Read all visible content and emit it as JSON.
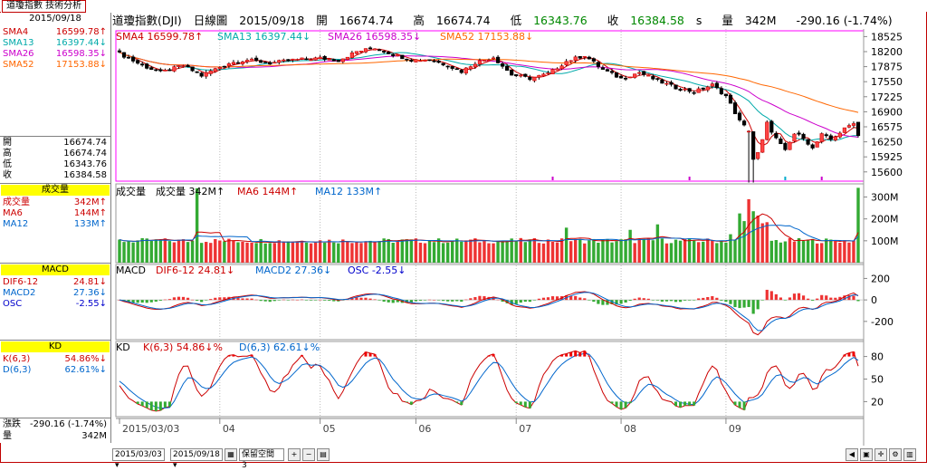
{
  "app": {
    "tab_label": "道瓊指數 技術分析"
  },
  "left": {
    "date": "2015/09/18",
    "sma": [
      {
        "label": "SMA4",
        "value": "16599.78",
        "arrow": "↑",
        "color": "#cc0000"
      },
      {
        "label": "SMA13",
        "value": "16397.44",
        "arrow": "↓",
        "color": "#00aaaa"
      },
      {
        "label": "SMA26",
        "value": "16598.35",
        "arrow": "↓",
        "color": "#cc00cc"
      },
      {
        "label": "SMA52",
        "value": "17153.88",
        "arrow": "↓",
        "color": "#ff6600"
      }
    ],
    "ohlc": [
      {
        "label": "開",
        "value": "16674.74"
      },
      {
        "label": "高",
        "value": "16674.74"
      },
      {
        "label": "低",
        "value": "16343.76"
      },
      {
        "label": "收",
        "value": "16384.58"
      }
    ],
    "vol_title": "成交量",
    "vol": [
      {
        "label": "成交量",
        "value": "342M",
        "arrow": "↑",
        "color": "#cc0000"
      },
      {
        "label": "MA6",
        "value": "144M",
        "arrow": "↑",
        "color": "#cc0000"
      },
      {
        "label": "MA12",
        "value": "133M",
        "arrow": "↑",
        "color": "#0066cc"
      }
    ],
    "macd_title": "MACD",
    "macd": [
      {
        "label": "DIF6-12",
        "value": "24.81",
        "arrow": "↓",
        "color": "#cc0000"
      },
      {
        "label": "MACD2",
        "value": "27.36",
        "arrow": "↓",
        "color": "#0066cc"
      },
      {
        "label": "OSC",
        "value": "-2.55",
        "arrow": "↓",
        "color": "#0000cc"
      }
    ],
    "kd_title": "KD",
    "kd": [
      {
        "label": "K(6,3)",
        "value": "54.86%",
        "arrow": "↓",
        "color": "#cc0000"
      },
      {
        "label": "D(6,3)",
        "value": "62.61%",
        "arrow": "↓",
        "color": "#0066cc"
      }
    ],
    "change_label": "漲跌",
    "change_value": "-290.16 (-1.74%)",
    "volume_label": "量",
    "volume_value": "342M"
  },
  "header": {
    "name": "道瓊指數(DJI)",
    "period": "日線圖",
    "date": "2015/09/18",
    "open_label": "開",
    "open": "16674.74",
    "high_label": "高",
    "high": "16674.74",
    "low_label": "低",
    "low": "16343.76",
    "close_label": "收",
    "close": "16384.58",
    "close_suffix": "s",
    "vol_label": "量",
    "vol": "342M",
    "change": "-290.16 (-1.74%)"
  },
  "panels": {
    "price": {
      "sma4": "SMA4 16599.78↑",
      "sma13": "SMA13 16397.44↓",
      "sma26": "SMA26 16598.35↓",
      "sma52": "SMA52 17153.88↓"
    },
    "volume": {
      "title": "成交量",
      "vol": "成交量 342M↑",
      "ma6": "MA6 144M↑",
      "ma12": "MA12 133M↑"
    },
    "macd": {
      "title": "MACD",
      "dif": "DIF6-12 24.81↓",
      "macd2": "MACD2 27.36↓",
      "osc": "OSC -2.55↓"
    },
    "kd": {
      "title": "KD",
      "k": "K(6,3) 54.86↓%",
      "d": "D(6,3) 62.61↓%"
    }
  },
  "bottom": {
    "start_date": "2015/03/03",
    "end_date": "2015/09/18",
    "btn_label": "保留空間",
    "btn_num": "3"
  },
  "chart_data": [
    {
      "type": "candlestick",
      "title": "道瓊指數(DJI) 日線圖",
      "x_ticks": [
        "2015/03/03",
        "04",
        "05",
        "06",
        "07",
        "08",
        "09"
      ],
      "y_ticks": [
        18525,
        18200,
        17875,
        17550,
        17225,
        16900,
        16575,
        16250,
        15925,
        15600
      ],
      "ylim": [
        15400,
        18650
      ],
      "close_anchors": [
        [
          0,
          18160
        ],
        [
          5,
          17900
        ],
        [
          9,
          17750
        ],
        [
          14,
          17900
        ],
        [
          18,
          17680
        ],
        [
          20,
          17780
        ],
        [
          24,
          17950
        ],
        [
          28,
          18020
        ],
        [
          33,
          17950
        ],
        [
          38,
          18020
        ],
        [
          44,
          18060
        ],
        [
          48,
          18010
        ],
        [
          52,
          18200
        ],
        [
          56,
          18280
        ],
        [
          60,
          18140
        ],
        [
          64,
          18020
        ],
        [
          68,
          18030
        ],
        [
          72,
          17900
        ],
        [
          75,
          17770
        ],
        [
          78,
          17960
        ],
        [
          82,
          18080
        ],
        [
          86,
          17700
        ],
        [
          90,
          17620
        ],
        [
          94,
          17720
        ],
        [
          98,
          17990
        ],
        [
          102,
          18120
        ],
        [
          106,
          17810
        ],
        [
          110,
          17620
        ],
        [
          114,
          17750
        ],
        [
          118,
          17570
        ],
        [
          122,
          17420
        ],
        [
          126,
          17330
        ],
        [
          130,
          17480
        ],
        [
          133,
          17240
        ],
        [
          136,
          16700
        ],
        [
          138,
          16480
        ],
        [
          139,
          15870
        ],
        [
          140,
          16000
        ],
        [
          141,
          16280
        ],
        [
          142,
          16650
        ],
        [
          144,
          16320
        ],
        [
          146,
          16050
        ],
        [
          148,
          16420
        ],
        [
          150,
          16350
        ],
        [
          152,
          16100
        ],
        [
          154,
          16400
        ],
        [
          156,
          16300
        ],
        [
          158,
          16450
        ],
        [
          160,
          16600
        ],
        [
          161,
          16674
        ],
        [
          162,
          16384
        ]
      ],
      "series": [
        {
          "name": "SMA4",
          "color": "#cc0000"
        },
        {
          "name": "SMA13",
          "color": "#00aaaa"
        },
        {
          "name": "SMA26",
          "color": "#cc00cc"
        },
        {
          "name": "SMA52",
          "color": "#ff6600"
        }
      ]
    },
    {
      "type": "bar",
      "title": "成交量",
      "y_ticks": [
        "100M",
        "200M",
        "300M"
      ],
      "ylim": [
        0,
        360
      ],
      "unit": "M",
      "vol_base_M": 100,
      "vol_spikes": [
        [
          17,
          340
        ],
        [
          98,
          160
        ],
        [
          112,
          150
        ],
        [
          118,
          175
        ],
        [
          134,
          130
        ],
        [
          136,
          225
        ],
        [
          137,
          190
        ],
        [
          138,
          290
        ],
        [
          139,
          235
        ],
        [
          140,
          215
        ],
        [
          141,
          180
        ],
        [
          142,
          185
        ],
        [
          162,
          342
        ]
      ],
      "series": [
        {
          "name": "MA6",
          "color": "#cc0000"
        },
        {
          "name": "MA12",
          "color": "#0066cc"
        }
      ]
    },
    {
      "type": "bar",
      "title": "MACD",
      "y_ticks": [
        200,
        0,
        -200
      ],
      "ylim": [
        -370,
        330
      ],
      "series": [
        {
          "name": "DIF6-12",
          "color": "#cc0000"
        },
        {
          "name": "MACD2",
          "color": "#0066cc"
        },
        {
          "name": "OSC",
          "color": "#0000cc"
        }
      ]
    },
    {
      "type": "line",
      "title": "KD",
      "y_ticks": [
        80,
        50,
        20
      ],
      "ylim": [
        0,
        100
      ],
      "series": [
        {
          "name": "K(6,3)",
          "color": "#cc0000"
        },
        {
          "name": "D(6,3)",
          "color": "#0066cc"
        }
      ]
    }
  ]
}
